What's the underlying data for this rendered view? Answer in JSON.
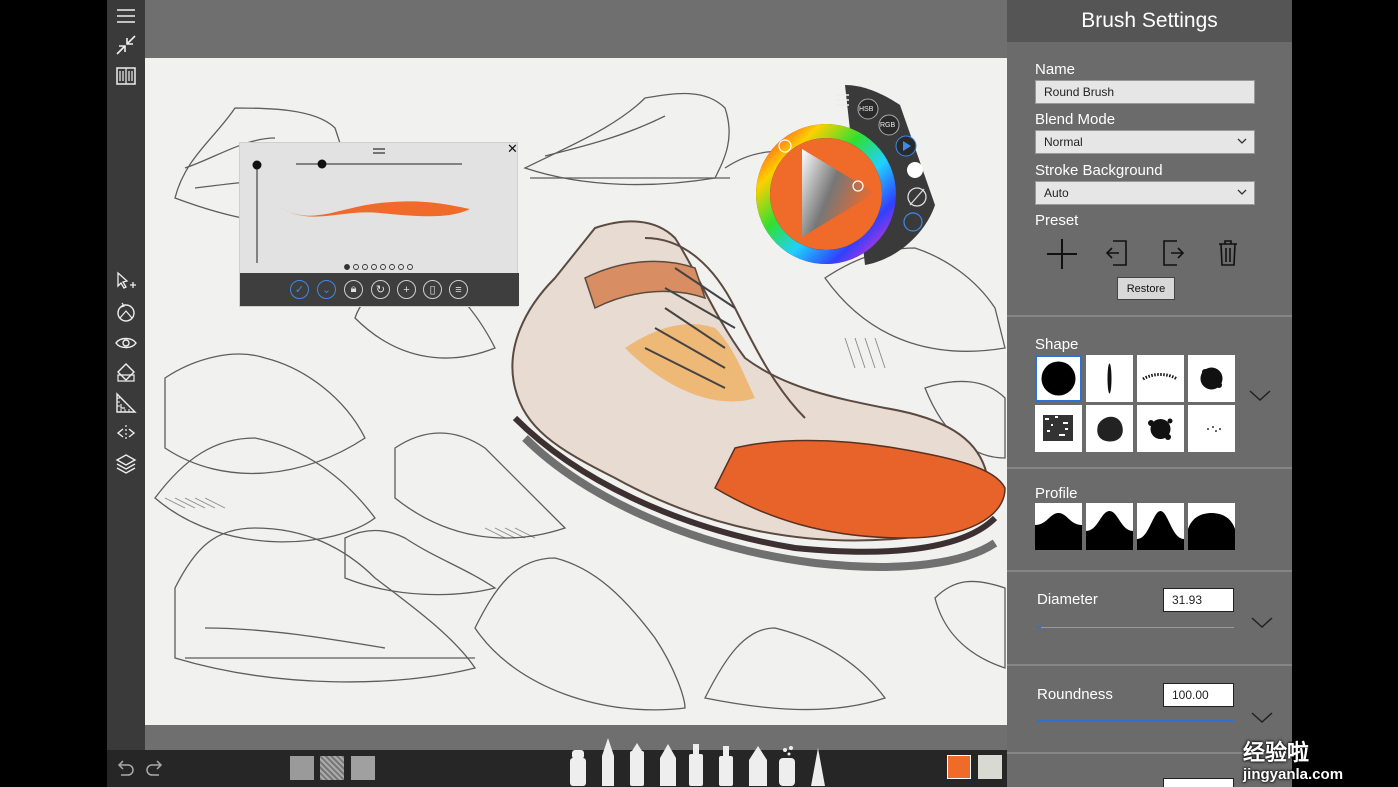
{
  "panel": {
    "title": "Brush Settings",
    "name_label": "Name",
    "name_value": "Round Brush",
    "blend_label": "Blend Mode",
    "blend_value": "Normal",
    "stroke_label": "Stroke Background",
    "stroke_value": "Auto",
    "preset_label": "Preset",
    "restore_label": "Restore",
    "shape_label": "Shape",
    "profile_label": "Profile",
    "diameter_label": "Diameter",
    "diameter_value": "31.93",
    "diameter_level": 0.02,
    "roundness_label": "Roundness",
    "roundness_value": "100.00",
    "roundness_level": 1.0
  },
  "color_puck": {
    "hsb_label": "HSB",
    "rgb_label": "RGB"
  },
  "colors": {
    "accent": "#2c72d6",
    "primary_swatch": "#f06a2a",
    "secondary_swatch": "#d9d9d3",
    "stroke_preview": "#f06a2a"
  },
  "watermark": {
    "text": "经验啦",
    "url": "jingyanla.com"
  },
  "icons": [
    "menu-icon",
    "collapse-icon",
    "book-icon",
    "select-transform-icon",
    "rotate-icon",
    "eye-icon",
    "fill-icon",
    "ruler-icon",
    "symmetry-icon",
    "layers-icon",
    "undo-icon",
    "redo-icon"
  ]
}
